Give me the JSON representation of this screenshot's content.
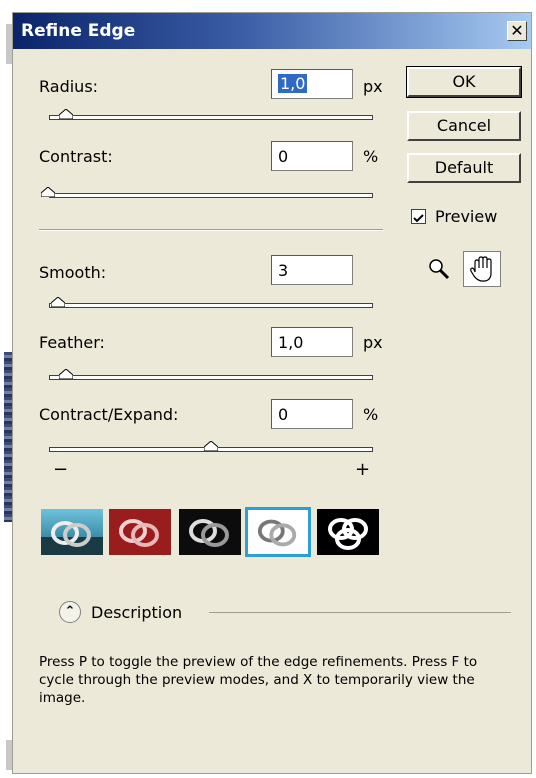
{
  "dialog": {
    "title": "Refine Edge",
    "close_glyph": "✕"
  },
  "radius": {
    "label": "Radius:",
    "value": "1,0",
    "unit": "px",
    "slider": 0.05
  },
  "contrast": {
    "label": "Contrast:",
    "value": "0",
    "unit": "%",
    "slider": 0.0
  },
  "smooth": {
    "label": "Smooth:",
    "value": "3",
    "unit": "",
    "slider": 0.03
  },
  "feather": {
    "label": "Feather:",
    "value": "1,0",
    "unit": "px",
    "slider": 0.05
  },
  "contract": {
    "label": "Contract/Expand:",
    "value": "0",
    "unit": "%",
    "slider": 0.5,
    "minus": "−",
    "plus": "+"
  },
  "buttons": {
    "ok": "OK",
    "cancel": "Cancel",
    "default": "Default"
  },
  "preview": {
    "label": "Preview",
    "checked": true
  },
  "tools": [
    "zoom-tool-icon",
    "hand-tool-icon"
  ],
  "modes": [
    {
      "name": "standard-mode",
      "bg": "#2a89a8"
    },
    {
      "name": "quick-mask-mode",
      "bg": "#a02020"
    },
    {
      "name": "on-black-mode",
      "bg": "#111111"
    },
    {
      "name": "on-white-mode",
      "bg": "#ffffff",
      "selected": true
    },
    {
      "name": "mask-mode",
      "bg": "#000000"
    }
  ],
  "description": {
    "heading": "Description",
    "toggle_glyph": "⌃",
    "text": "Press P to toggle the preview of the edge refinements. Press F to cycle through the preview modes, and X to temporarily view the image."
  }
}
